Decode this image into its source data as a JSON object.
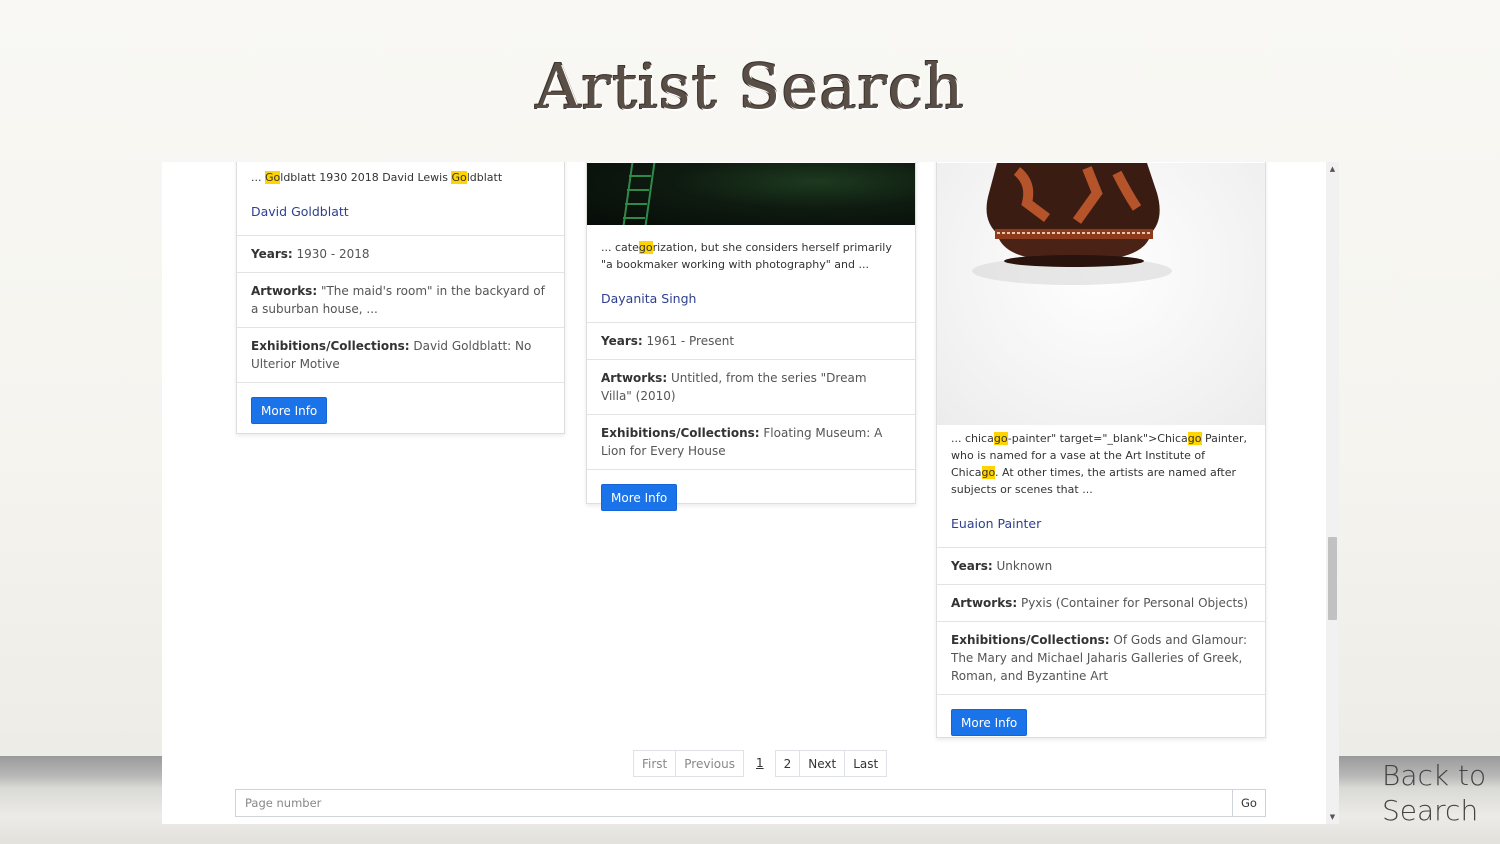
{
  "header": {
    "title": "Artist Search"
  },
  "cards": [
    {
      "snippet_parts": [
        {
          "t": "... ",
          "hl": false
        },
        {
          "t": "Go",
          "hl": true
        },
        {
          "t": "ldblatt 1930 2018 David Lewis ",
          "hl": false
        },
        {
          "t": "Go",
          "hl": true
        },
        {
          "t": "ldblatt",
          "hl": false
        }
      ],
      "name": "David Goldblatt",
      "years_label": "Years:",
      "years": "1930 - 2018",
      "artworks_label": "Artworks:",
      "artworks": "\"The maid's room\" in the backyard of a suburban house, ...",
      "exhibitions_label": "Exhibitions/Collections:",
      "exhibitions": "David Goldblatt: No Ulterior Motive",
      "button": "More Info"
    },
    {
      "snippet_parts": [
        {
          "t": "... cate",
          "hl": false
        },
        {
          "t": "go",
          "hl": true
        },
        {
          "t": "rization, but she considers herself primarily \"a bookmaker working with photography\" and ...",
          "hl": false
        }
      ],
      "name": "Dayanita Singh",
      "years_label": "Years:",
      "years": "1961 - Present",
      "artworks_label": "Artworks:",
      "artworks": "Untitled, from the series \"Dream Villa\" (2010)",
      "exhibitions_label": "Exhibitions/Collections:",
      "exhibitions": "Floating Museum: A Lion for Every House",
      "button": "More Info"
    },
    {
      "snippet_parts": [
        {
          "t": "... chica",
          "hl": false
        },
        {
          "t": "go",
          "hl": true
        },
        {
          "t": "-painter\" target=\"_blank\">Chica",
          "hl": false
        },
        {
          "t": "go",
          "hl": true
        },
        {
          "t": " Painter, who is named for a vase at the Art Institute of Chica",
          "hl": false
        },
        {
          "t": "go",
          "hl": true
        },
        {
          "t": ". At other times, the artists are named after subjects or scenes that ...",
          "hl": false
        }
      ],
      "name": "Euaion Painter",
      "years_label": "Years:",
      "years": "Unknown",
      "artworks_label": "Artworks:",
      "artworks": "Pyxis (Container for Personal Objects)",
      "exhibitions_label": "Exhibitions/Collections:",
      "exhibitions": "Of Gods and Glamour: The Mary and Michael Jaharis Galleries of Greek, Roman, and Byzantine Art",
      "button": "More Info"
    }
  ],
  "pagination": {
    "first": "First",
    "previous": "Previous",
    "current": "1",
    "page2": "2",
    "next": "Next",
    "last": "Last"
  },
  "page_jump": {
    "placeholder": "Page number",
    "go": "Go"
  },
  "back_link": "Back to Search",
  "colors": {
    "primary_button": "#1a73e8",
    "highlight": "#ffd400",
    "link": "#2f3f8f"
  }
}
